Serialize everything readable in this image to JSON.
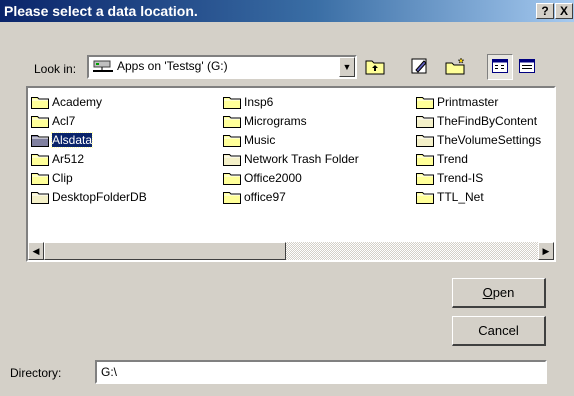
{
  "dialog": {
    "title": "Please select a data location.",
    "help_glyph": "?",
    "close_glyph": "X"
  },
  "lookin": {
    "label": "Look in:",
    "value": "Apps on 'Testsg' (G:)"
  },
  "files": {
    "columns": [
      [
        {
          "name": "Academy",
          "style": "normal"
        },
        {
          "name": "Acl7",
          "style": "normal"
        },
        {
          "name": "Alsdata",
          "style": "selected"
        },
        {
          "name": "Ar512",
          "style": "normal"
        },
        {
          "name": "Clip",
          "style": "normal"
        },
        {
          "name": "DesktopFolderDB",
          "style": "pale"
        }
      ],
      [
        {
          "name": "Insp6",
          "style": "normal"
        },
        {
          "name": "Micrograms",
          "style": "normal"
        },
        {
          "name": "Music",
          "style": "normal"
        },
        {
          "name": "Network Trash Folder",
          "style": "pale"
        },
        {
          "name": "Office2000",
          "style": "normal"
        },
        {
          "name": "office97",
          "style": "normal"
        }
      ],
      [
        {
          "name": "Printmaster",
          "style": "normal"
        },
        {
          "name": "TheFindByContent",
          "style": "pale"
        },
        {
          "name": "TheVolumeSettings",
          "style": "pale"
        },
        {
          "name": "Trend",
          "style": "normal"
        },
        {
          "name": "Trend-IS",
          "style": "normal"
        },
        {
          "name": "TTL_Net",
          "style": "normal"
        }
      ]
    ]
  },
  "buttons": {
    "open_mnemonic": "O",
    "open_rest": "pen",
    "cancel": "Cancel"
  },
  "directory": {
    "label": "Directory:",
    "value": "G:\\"
  },
  "colors": {
    "folder": "#ffff99",
    "folder_pale": "#f4f0c8",
    "selection": "#0a246a"
  }
}
